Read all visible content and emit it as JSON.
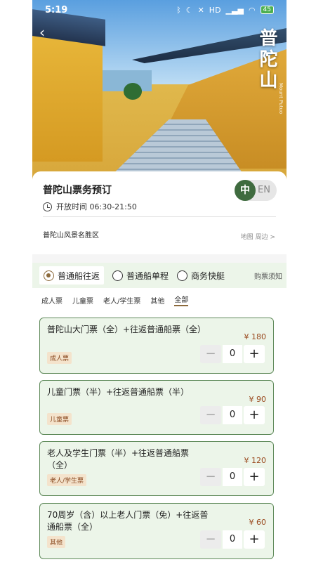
{
  "status_bar": {
    "time": "5:19",
    "battery": "45",
    "signal": "HD"
  },
  "hero": {
    "logo_text": "普陀山",
    "logo_sub": "Mount Putuo"
  },
  "header": {
    "title": "普陀山票务预订",
    "lang_active": "中",
    "lang_inactive": "EN",
    "hours": "开放时间 06:30-21:50",
    "scenic_area": "普陀山风景名胜区",
    "nearby_link": "地图 周边 >"
  },
  "ferry_options": [
    {
      "label": "普通船往返",
      "selected": true
    },
    {
      "label": "普通船单程",
      "selected": false
    },
    {
      "label": "商务快艇",
      "selected": false
    }
  ],
  "ticket_notice": "购票须知",
  "filter_tabs": [
    "成人票",
    "儿童票",
    "老人/学生票",
    "其他",
    "全部"
  ],
  "active_tab": "全部",
  "tickets": [
    {
      "name": "普陀山大门票（全）+往返普通船票（全）",
      "price": "¥ 180",
      "tag": "成人票",
      "qty": "0"
    },
    {
      "name": "儿童门票（半）+往返普通船票（半）",
      "price": "¥ 90",
      "tag": "儿童票",
      "qty": "0"
    },
    {
      "name": "老人及学生门票（半）+往返普通船票（全）",
      "price": "¥ 120",
      "tag": "老人/学生票",
      "qty": "0"
    },
    {
      "name": "70周岁（含）以上老人门票（免）+往返普通船票（全）",
      "price": "¥ 60",
      "tag": "其他",
      "qty": "0"
    }
  ],
  "stepper": {
    "minus": "−",
    "plus": "+"
  },
  "colors": {
    "accent": "#3f6b3f",
    "card_bg": "#ecf5e9",
    "price": "#9a4a1f",
    "tag_text": "#8a4a20"
  }
}
